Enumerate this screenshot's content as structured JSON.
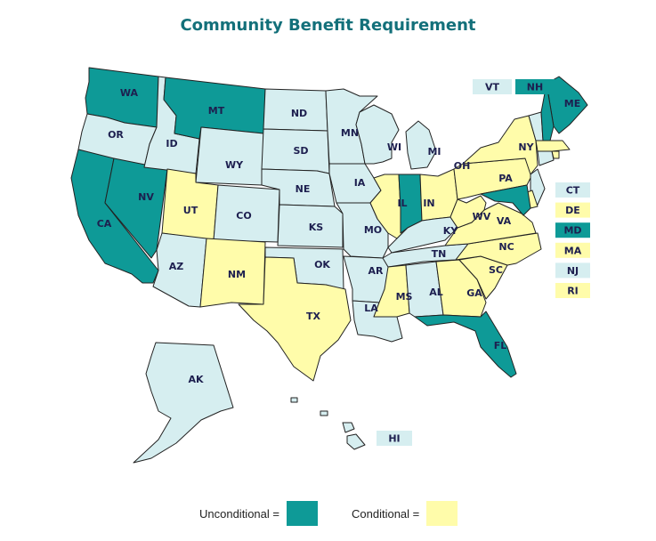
{
  "title": "Community Benefit Requirement",
  "colors": {
    "unconditional": "#0e9a97",
    "conditional": "#fffcaa",
    "none": "#d6eef0",
    "title": "#13707a",
    "label": "#1d1f4f"
  },
  "legend": {
    "unconditional_label": "Unconditional =",
    "conditional_label": "Conditional ="
  },
  "states": {
    "WA": {
      "label": "WA",
      "status": "unconditional"
    },
    "OR": {
      "label": "OR",
      "status": "none"
    },
    "CA": {
      "label": "CA",
      "status": "unconditional"
    },
    "NV": {
      "label": "NV",
      "status": "unconditional"
    },
    "ID": {
      "label": "ID",
      "status": "none"
    },
    "MT": {
      "label": "MT",
      "status": "unconditional"
    },
    "WY": {
      "label": "WY",
      "status": "none"
    },
    "UT": {
      "label": "UT",
      "status": "conditional"
    },
    "CO": {
      "label": "CO",
      "status": "none"
    },
    "AZ": {
      "label": "AZ",
      "status": "none"
    },
    "NM": {
      "label": "NM",
      "status": "conditional"
    },
    "ND": {
      "label": "ND",
      "status": "none"
    },
    "SD": {
      "label": "SD",
      "status": "none"
    },
    "NE": {
      "label": "NE",
      "status": "none"
    },
    "KS": {
      "label": "KS",
      "status": "none"
    },
    "OK": {
      "label": "OK",
      "status": "none"
    },
    "TX": {
      "label": "TX",
      "status": "conditional"
    },
    "MN": {
      "label": "MN",
      "status": "none"
    },
    "IA": {
      "label": "IA",
      "status": "none"
    },
    "MO": {
      "label": "MO",
      "status": "none"
    },
    "AR": {
      "label": "AR",
      "status": "none"
    },
    "LA": {
      "label": "LA",
      "status": "none"
    },
    "WI": {
      "label": "WI",
      "status": "none"
    },
    "IL": {
      "label": "IL",
      "status": "conditional"
    },
    "MI": {
      "label": "MI",
      "status": "none"
    },
    "IN": {
      "label": "IN",
      "status": "unconditional"
    },
    "OH": {
      "label": "OH",
      "status": "conditional"
    },
    "KY": {
      "label": "KY",
      "status": "none"
    },
    "TN": {
      "label": "TN",
      "status": "none"
    },
    "MS": {
      "label": "MS",
      "status": "conditional"
    },
    "AL": {
      "label": "AL",
      "status": "none"
    },
    "GA": {
      "label": "GA",
      "status": "conditional"
    },
    "FL": {
      "label": "FL",
      "status": "unconditional"
    },
    "SC": {
      "label": "SC",
      "status": "conditional"
    },
    "NC": {
      "label": "NC",
      "status": "conditional"
    },
    "VA": {
      "label": "VA",
      "status": "conditional"
    },
    "WV": {
      "label": "WV",
      "status": "conditional"
    },
    "PA": {
      "label": "PA",
      "status": "conditional"
    },
    "NY": {
      "label": "NY",
      "status": "conditional"
    },
    "ME": {
      "label": "ME",
      "status": "unconditional"
    },
    "VT": {
      "label": "VT",
      "status": "none"
    },
    "NH": {
      "label": "NH",
      "status": "unconditional"
    },
    "MA": {
      "label": "MA",
      "status": "conditional"
    },
    "RI": {
      "label": "RI",
      "status": "conditional"
    },
    "CT": {
      "label": "CT",
      "status": "none"
    },
    "NJ": {
      "label": "NJ",
      "status": "none"
    },
    "DE": {
      "label": "DE",
      "status": "conditional"
    },
    "MD": {
      "label": "MD",
      "status": "unconditional"
    },
    "AK": {
      "label": "AK",
      "status": "none"
    },
    "HI": {
      "label": "HI",
      "status": "none"
    }
  },
  "callouts_top": [
    "VT",
    "NH"
  ],
  "callouts_side": [
    "CT",
    "DE",
    "MD",
    "MA",
    "NJ",
    "RI"
  ],
  "callouts_hi": [
    "HI"
  ]
}
